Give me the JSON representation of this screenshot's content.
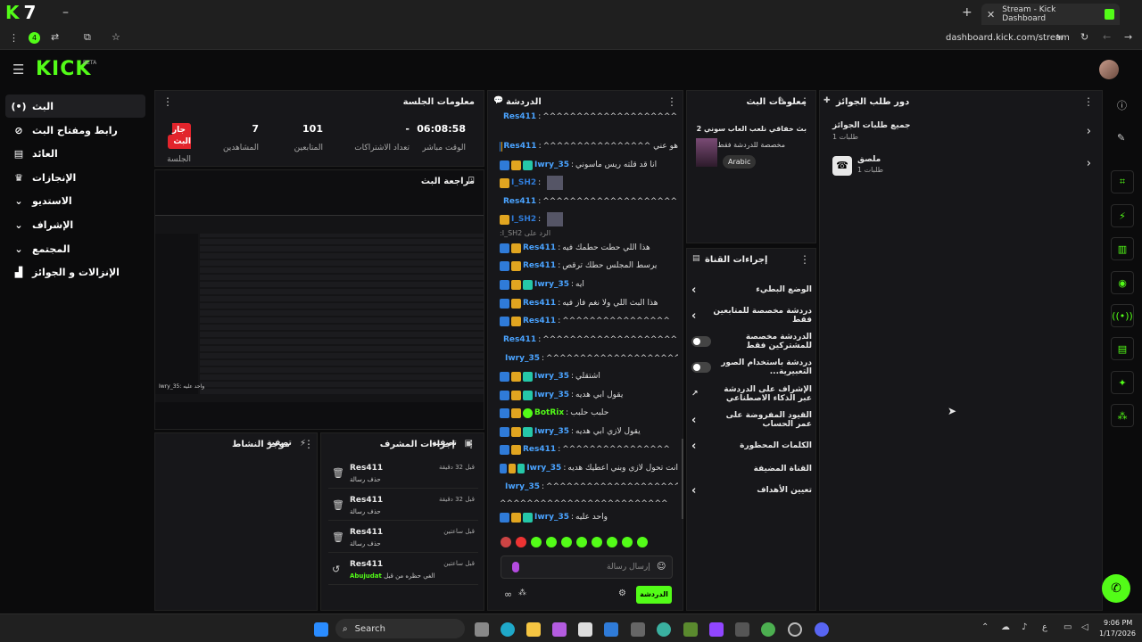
{
  "browser": {
    "tab_title": "Stream - Kick Dashboard",
    "url": "dashboard.kick.com/stream",
    "channel_badge": "7",
    "extension_count": "4"
  },
  "header": {
    "logo": "KICK",
    "beta": "BETA"
  },
  "nav": {
    "items": [
      {
        "label": "البث",
        "icon": "live-icon",
        "glyph": "(•)"
      },
      {
        "label": "رابط ومفتاح البث",
        "icon": "link-icon",
        "glyph": "⊘"
      },
      {
        "label": "العائد",
        "icon": "revenue-icon",
        "glyph": "▤"
      },
      {
        "label": "الإنجازات",
        "icon": "trophy-icon",
        "glyph": "♛"
      },
      {
        "label": "الاستديو",
        "icon": "studio-icon",
        "glyph": "⌄"
      },
      {
        "label": "الإشراف",
        "icon": "moderation-icon",
        "glyph": "⌄"
      },
      {
        "label": "المجتمع",
        "icon": "community-icon",
        "glyph": "⌄"
      },
      {
        "label": "الإنزالات و الجوائز",
        "icon": "drops-icon",
        "glyph": "▟"
      }
    ]
  },
  "session": {
    "title": "معلومات الجلسة",
    "live_badge": "جار البث",
    "live_label": "الجلسة",
    "stats": [
      {
        "value": "06:08:58",
        "label": "الوقت مباشر"
      },
      {
        "value": "-",
        "label": "تعداد الاشتراكات"
      },
      {
        "value": "101",
        "label": "المتابعين"
      },
      {
        "value": "7",
        "label": "المشاهدين"
      }
    ]
  },
  "preview": {
    "title": "مراجعة البث",
    "overlay": "Iwry_35: واحد عليه"
  },
  "activity": {
    "title": "موجز النشاط",
    "filter": "تصفية"
  },
  "modactions": {
    "title": "إجراءات المشرف",
    "filter": "تصفية",
    "items": [
      {
        "user": "Res411",
        "action": "حذف رسالة",
        "time": "قبل 32 دقيقة"
      },
      {
        "user": "Res411",
        "action": "حذف رسالة",
        "time": "قبل 32 دقيقة"
      },
      {
        "user": "Res411",
        "action": "حذف رسالة",
        "time": "قبل ساعتين"
      },
      {
        "user": "Res411",
        "action": "الغي حظره من قبل",
        "extra": "Abujudat",
        "time": "قبل ساعتين"
      }
    ]
  },
  "chat": {
    "title": "الدردشة",
    "input_placeholder": "إرسال رسالة",
    "send_label": "الدردشة",
    "messages": [
      {
        "user": "Res411",
        "text": "^^^^^^^^^^^^^^^^^^^^^^^^^^^^^^^^^",
        "mod": true,
        "vip": true,
        "sub": false
      },
      {
        "user": "Res411",
        "text": "هو عني ^^^^^^^^^^^^^^^^",
        "mod": true,
        "vip": true,
        "sub": false
      },
      {
        "user": "Iwry_35",
        "text": "انا قد قلته ريس ماسوني",
        "mod": true,
        "vip": true,
        "sub": true
      },
      {
        "user": "I_SH2",
        "text": "",
        "mod": false,
        "vip": true,
        "sub": false
      },
      {
        "user": "Res411",
        "text": "^^^^^^^^^^^^^^^^^^^^^^^^^^^^^^^^^",
        "mod": true,
        "vip": true,
        "sub": false
      },
      {
        "user": "I_SH2",
        "text": "",
        "mod": false,
        "vip": true,
        "sub": false
      },
      {
        "user": "Res411",
        "text": "هذا اللي حطت حطمك فيه",
        "mod": true,
        "vip": true,
        "sub": false,
        "reply": "الرد على I_SH2:"
      },
      {
        "user": "Res411",
        "text": "يرسط المجلس حطك ترقص",
        "mod": true,
        "vip": true,
        "sub": false
      },
      {
        "user": "Iwry_35",
        "text": "ايه",
        "mod": true,
        "vip": true,
        "sub": true
      },
      {
        "user": "Res411",
        "text": "هذا البث اللي ولا نغم فاز فيه",
        "mod": true,
        "vip": true,
        "sub": false
      },
      {
        "user": "Res411",
        "text": "^^^^^^^^^^^^^^^^",
        "mod": true,
        "vip": true,
        "sub": false
      },
      {
        "user": "Res411",
        "text": "^^^^^^^^^^^^^^^^^^^^^^^^^^^^^^^^^",
        "mod": true,
        "vip": true,
        "sub": false
      },
      {
        "user": "Iwry_35",
        "text": "^^^^^^^^^^^^^^^^^^^^^^^^^",
        "mod": true,
        "vip": true,
        "sub": true
      },
      {
        "user": "Iwry_35",
        "text": "اشتقلي",
        "mod": true,
        "vip": true,
        "sub": true
      },
      {
        "user": "Iwry_35",
        "text": "يقول ابي هديه",
        "mod": true,
        "vip": true,
        "sub": true
      },
      {
        "user": "BotRix",
        "text": "حلبب حلبب",
        "mod": true,
        "vip": true,
        "sub": false,
        "bot": true
      },
      {
        "user": "Iwry_35",
        "text": "يقول لازي ابي هديه",
        "mod": true,
        "vip": true,
        "sub": true
      },
      {
        "user": "Res411",
        "text": "^^^^^^^^^^^^^^^^",
        "mod": true,
        "vip": true,
        "sub": false
      },
      {
        "user": "Iwry_35",
        "text": "انت تحول لازي وبني اعطيك هديه",
        "mod": true,
        "vip": true,
        "sub": true
      },
      {
        "user": "Iwry_35",
        "text": "^^^^^^^^^^^^^^^^^^^^^^^^^^",
        "mod": true,
        "vip": true,
        "sub": true
      },
      {
        "user": "",
        "text": "^^^^^^^^^^^^^^^^^^^^^^^^^",
        "mod": false,
        "vip": false,
        "sub": false
      },
      {
        "user": "Iwry_35",
        "text": "واحد عليه",
        "mod": true,
        "vip": true,
        "sub": true
      }
    ]
  },
  "streaminfo": {
    "title": "معلومات البث",
    "stream_title": "بث خفاقي نلعب العاب سوني 2",
    "subtitle": "مخصصة للدردشة فقط",
    "tag": "Arabic"
  },
  "channelactions": {
    "title": "إجراءات القناة",
    "items": [
      {
        "label": "الوضع البطيء",
        "control": "chevron"
      },
      {
        "label": "دردشة مخصصة للمتابعين فقط",
        "control": "chevron"
      },
      {
        "label": "الدردشة مخصصة للمشتركين فقط",
        "control": "toggle"
      },
      {
        "label": "دردشة باستخدام الصور التعبيرية...",
        "control": "toggle"
      },
      {
        "label": "الإشراف على الدردشة عبر الذكاء الاصطناعي",
        "control": "external"
      },
      {
        "label": "القيود المفروضة على عمر الحساب",
        "control": "chevron"
      },
      {
        "label": "الكلمات المحظورة",
        "control": "chevron"
      },
      {
        "label": "القناة المضيفة",
        "control": "none"
      },
      {
        "label": "تعيين الأهداف",
        "control": "chevron"
      }
    ]
  },
  "rewards": {
    "title": "دور طلب الجوائز",
    "items": [
      {
        "label": "جميع طلبات الجوائز",
        "sub": "طلبات 1"
      },
      {
        "label": "ملصق",
        "sub": "طلبات 1"
      }
    ]
  },
  "taskbar": {
    "search": "Search",
    "time": "9:06 PM",
    "date": "1/17/2026"
  }
}
